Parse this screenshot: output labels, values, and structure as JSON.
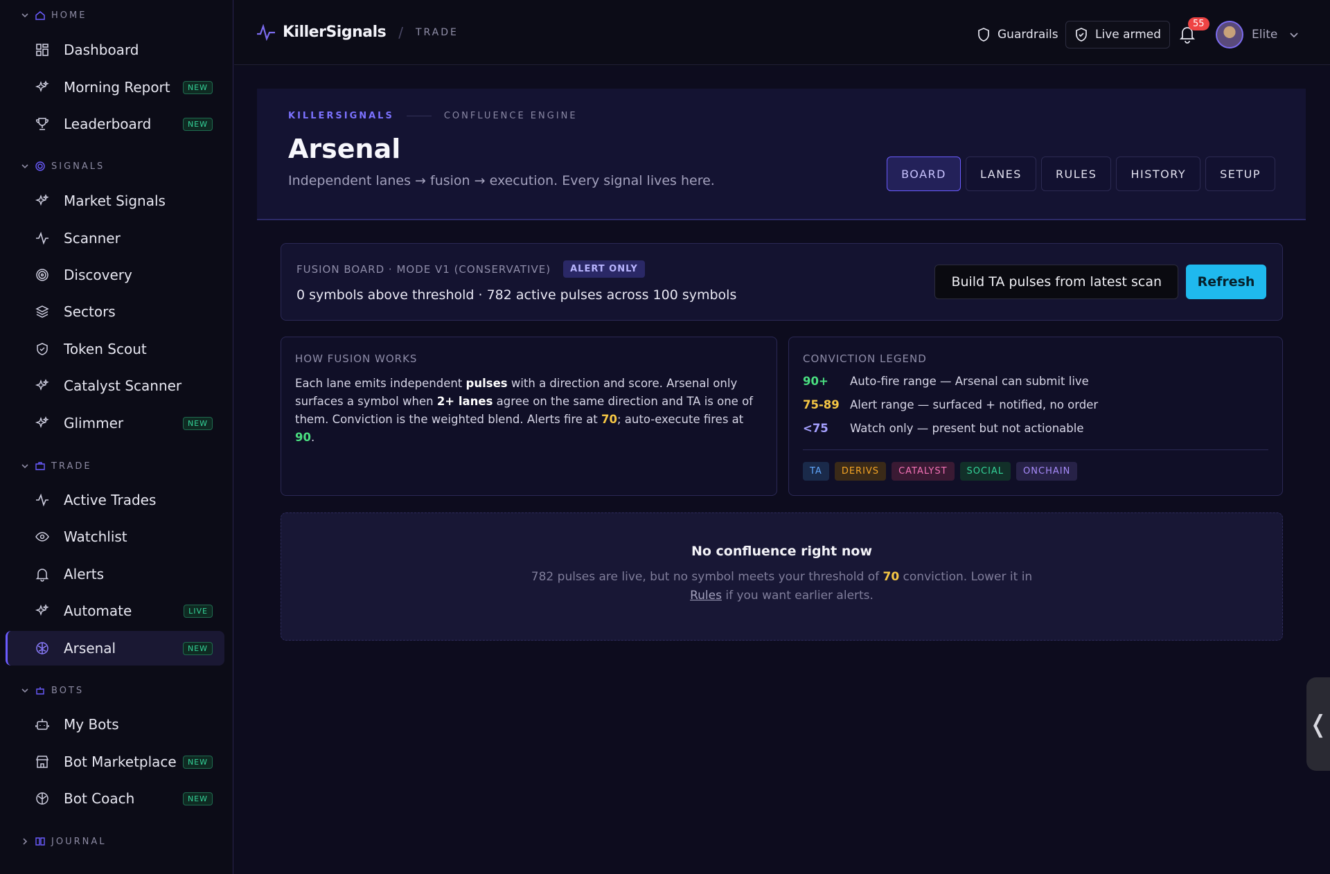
{
  "sidebar": {
    "sections": [
      {
        "label": "HOME"
      },
      {
        "label": "SIGNALS"
      },
      {
        "label": "TRADE"
      },
      {
        "label": "BOTS"
      },
      {
        "label": "JOURNAL"
      }
    ],
    "items": [
      {
        "label": "Dashboard",
        "icon": "grid-icon",
        "badge": ""
      },
      {
        "label": "Morning Report",
        "icon": "sparkle-icon",
        "badge": "NEW"
      },
      {
        "label": "Leaderboard",
        "icon": "trophy-icon",
        "badge": "NEW"
      },
      {
        "label": "Market Signals",
        "icon": "sparkle-icon",
        "badge": ""
      },
      {
        "label": "Scanner",
        "icon": "pulse-icon",
        "badge": ""
      },
      {
        "label": "Discovery",
        "icon": "target-icon",
        "badge": ""
      },
      {
        "label": "Sectors",
        "icon": "layers-icon",
        "badge": ""
      },
      {
        "label": "Token Scout",
        "icon": "shield-icon",
        "badge": ""
      },
      {
        "label": "Catalyst Scanner",
        "icon": "sparkle-icon",
        "badge": ""
      },
      {
        "label": "Glimmer",
        "icon": "sparkle-icon",
        "badge": "NEW"
      },
      {
        "label": "Active Trades",
        "icon": "pulse-icon",
        "badge": ""
      },
      {
        "label": "Watchlist",
        "icon": "eye-icon",
        "badge": ""
      },
      {
        "label": "Alerts",
        "icon": "bell-icon",
        "badge": ""
      },
      {
        "label": "Automate",
        "icon": "sparkle-icon",
        "badge": "LIVE"
      },
      {
        "label": "Arsenal",
        "icon": "brain-icon",
        "badge": "NEW"
      },
      {
        "label": "My Bots",
        "icon": "bot-icon",
        "badge": ""
      },
      {
        "label": "Bot Marketplace",
        "icon": "store-icon",
        "badge": "NEW"
      },
      {
        "label": "Bot Coach",
        "icon": "brain-icon",
        "badge": "NEW"
      }
    ]
  },
  "topbar": {
    "brand": "KillerSignals",
    "separator": "/",
    "crumb": "TRADE",
    "guardrails": "Guardrails",
    "live": "Live armed",
    "notifications": "55",
    "user": "Elite"
  },
  "hero": {
    "eyebrow_brand": "KILLERSIGNALS",
    "eyebrow_section": "CONFLUENCE ENGINE",
    "title": "Arsenal",
    "subtitle": "Independent lanes → fusion → execution. Every signal lives here.",
    "tabs": [
      "BOARD",
      "LANES",
      "RULES",
      "HISTORY",
      "SETUP"
    ],
    "active_tab": "BOARD"
  },
  "fusion": {
    "title": "FUSION BOARD · MODE V1 (CONSERVATIVE)",
    "mode_pill": "ALERT ONLY",
    "stat": "0 symbols above threshold · 782 active pulses across 100 symbols",
    "build_button": "Build TA pulses from latest scan",
    "refresh_button": "Refresh"
  },
  "how": {
    "title": "HOW FUSION WORKS",
    "p1": "Each lane emits independent ",
    "b1": "pulses",
    "p2": " with a direction and score. Arsenal only surfaces a symbol when ",
    "b2": "2+ lanes",
    "p3": " agree on the same direction and TA is one of them. Conviction is the weighted blend. Alerts fire at ",
    "alert_at": "70",
    "p4": "; auto-execute fires at ",
    "exec_at": "90",
    "p5": "."
  },
  "legend": {
    "title": "CONVICTION LEGEND",
    "rows": [
      {
        "key": "90+",
        "text": "Auto-fire range — Arsenal can submit live",
        "color": "#4ade80"
      },
      {
        "key": "75-89",
        "text": "Alert range — surfaced + notified, no order",
        "color": "#f6c744"
      },
      {
        "key": "<75",
        "text": "Watch only — present but not actionable",
        "color": "#a5a0ff"
      }
    ],
    "chips": [
      {
        "label": "TA",
        "color": "#60a5fa",
        "bg": "#1a2a4a"
      },
      {
        "label": "DERIVS",
        "color": "#f5a524",
        "bg": "#3a2a18"
      },
      {
        "label": "CATALYST",
        "color": "#f472b6",
        "bg": "#3a1a33"
      },
      {
        "label": "SOCIAL",
        "color": "#34d399",
        "bg": "#123029"
      },
      {
        "label": "ONCHAIN",
        "color": "#a78bfa",
        "bg": "#272247"
      }
    ]
  },
  "empty": {
    "title": "No confluence right now",
    "d1": "782 pulses are live, but no symbol meets your threshold of ",
    "threshold": "70",
    "d2": " conviction. Lower it in",
    "link": "Rules",
    "d3": " if you want earlier alerts."
  },
  "handle": "❬"
}
